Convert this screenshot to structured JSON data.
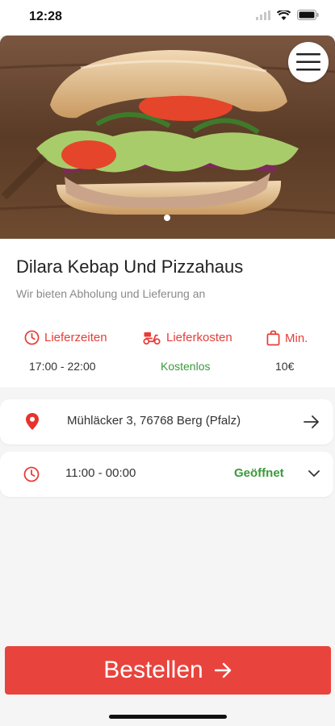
{
  "status_bar": {
    "time": "12:28"
  },
  "restaurant": {
    "name": "Dilara Kebap Und Pizzahaus",
    "tagline": "Wir bieten Abholung und Lieferung an"
  },
  "meta": {
    "delivery_times_label": "Lieferzeiten",
    "delivery_costs_label": "Lieferkosten",
    "minimum_label": "Min.",
    "delivery_times_value": "17:00 - 22:00",
    "delivery_costs_value": "Kostenlos",
    "minimum_value": "10€"
  },
  "address": {
    "text": "Mühläcker 3, 76768 Berg (Pfalz)"
  },
  "hours": {
    "time": "11:00 - 00:00",
    "status": "Geöffnet"
  },
  "order_button": {
    "label": "Bestellen"
  },
  "colors": {
    "accent": "#e8443d",
    "open_green": "#3a9a3a",
    "muted": "#8a8a8a"
  }
}
